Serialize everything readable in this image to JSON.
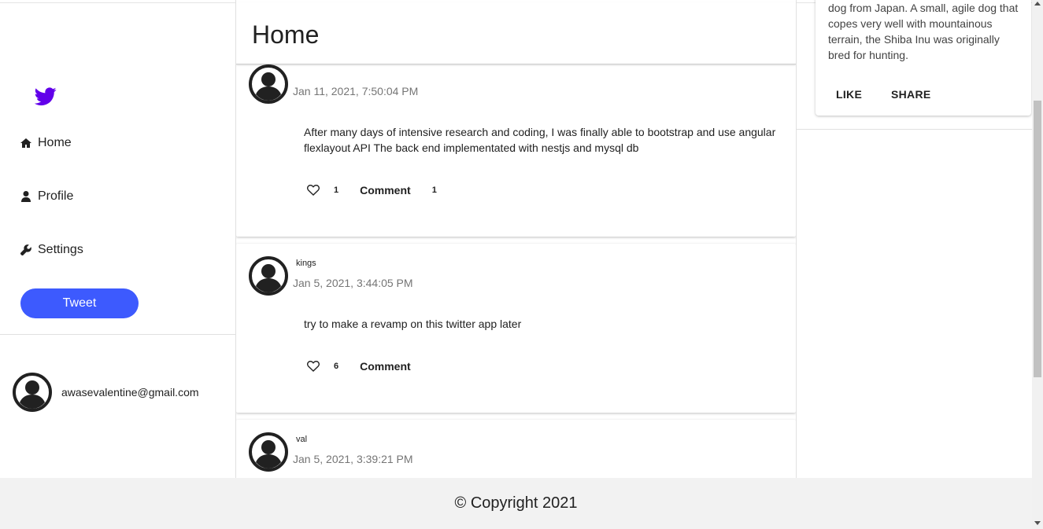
{
  "nav": {
    "brand_color": "#6200ea",
    "items": [
      {
        "label": "Home",
        "icon": "home-icon"
      },
      {
        "label": "Profile",
        "icon": "user-icon"
      },
      {
        "label": "Settings",
        "icon": "wrench-icon"
      }
    ],
    "tweet_label": "Tweet",
    "tweet_color": "#3d5afe",
    "user_email": "awasevalentine@gmail.com"
  },
  "main": {
    "title": "Home",
    "posts": [
      {
        "username": "",
        "date": "Jan 11, 2021, 7:50:04 PM",
        "body": "After many days of intensive research and coding, I was finally able to bootstrap and use angular flexlayout API The back end implementated with nestjs and mysql db",
        "likes": "1",
        "comment_label": "Comment",
        "comments": "1"
      },
      {
        "username": "kings",
        "date": "Jan 5, 2021, 3:44:05 PM",
        "body": "try to make a revamp on this twitter app later",
        "likes": "6",
        "comment_label": "Comment",
        "comments": ""
      },
      {
        "username": "val",
        "date": "Jan 5, 2021, 3:39:21 PM",
        "body": "",
        "likes": "",
        "comment_label": "",
        "comments": ""
      }
    ]
  },
  "aside": {
    "card_text": "dog from Japan. A small, agile dog that copes very well with mountainous terrain, the Shiba Inu was originally bred for hunting.",
    "like_label": "LIKE",
    "share_label": "SHARE"
  },
  "footer": {
    "text": "© Copyright 2021"
  }
}
